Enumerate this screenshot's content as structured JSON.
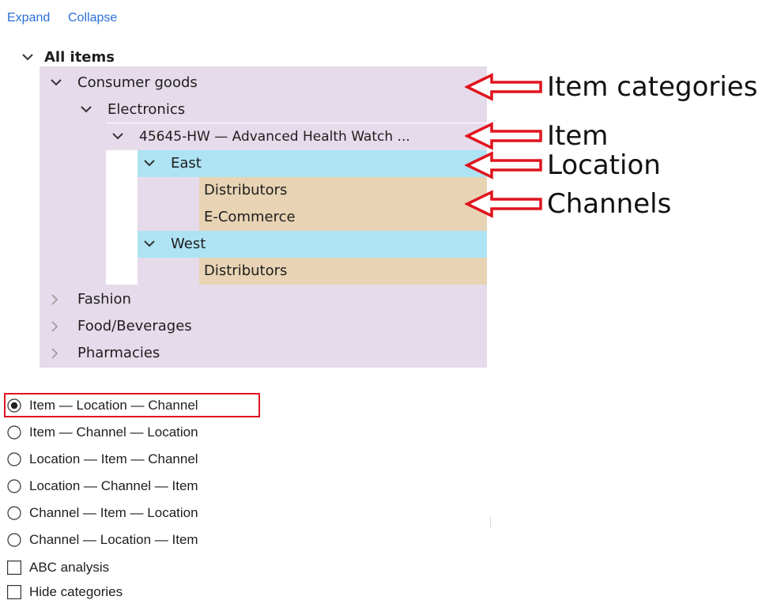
{
  "toolbar": {
    "expand_label": "Expand",
    "collapse_label": "Collapse"
  },
  "tree": {
    "root": "All items",
    "consumer_goods": "Consumer goods",
    "electronics": "Electronics",
    "item": "45645-HW — Advanced Health Watch ...",
    "east": "East",
    "east_channel_1": "Distributors",
    "east_channel_2": "E-Commerce",
    "west": "West",
    "west_channel_1": "Distributors",
    "fashion": "Fashion",
    "food": "Food/Beverages",
    "pharmacies": "Pharmacies"
  },
  "hierarchy_options": {
    "selected_index": 0,
    "items": [
      "Item — Location — Channel",
      "Item — Channel — Location",
      "Location — Item — Channel",
      "Location — Channel — Item",
      "Channel — Item — Location",
      "Channel — Location — Item"
    ]
  },
  "checkboxes": {
    "abc_analysis": {
      "label": "ABC analysis",
      "checked": false
    },
    "hide_categories": {
      "label": "Hide categories",
      "checked": false
    }
  },
  "annotations": {
    "item_categories": "Item categories",
    "item": "Item",
    "location": "Location",
    "channels": "Channels"
  },
  "colors": {
    "category_band": "#e6dbea",
    "location_band": "#aee3f4",
    "channel_band": "#e8d3b4",
    "link": "#2a6fd6",
    "highlight_border": "#e0141e",
    "arrow": "#e0141e"
  }
}
